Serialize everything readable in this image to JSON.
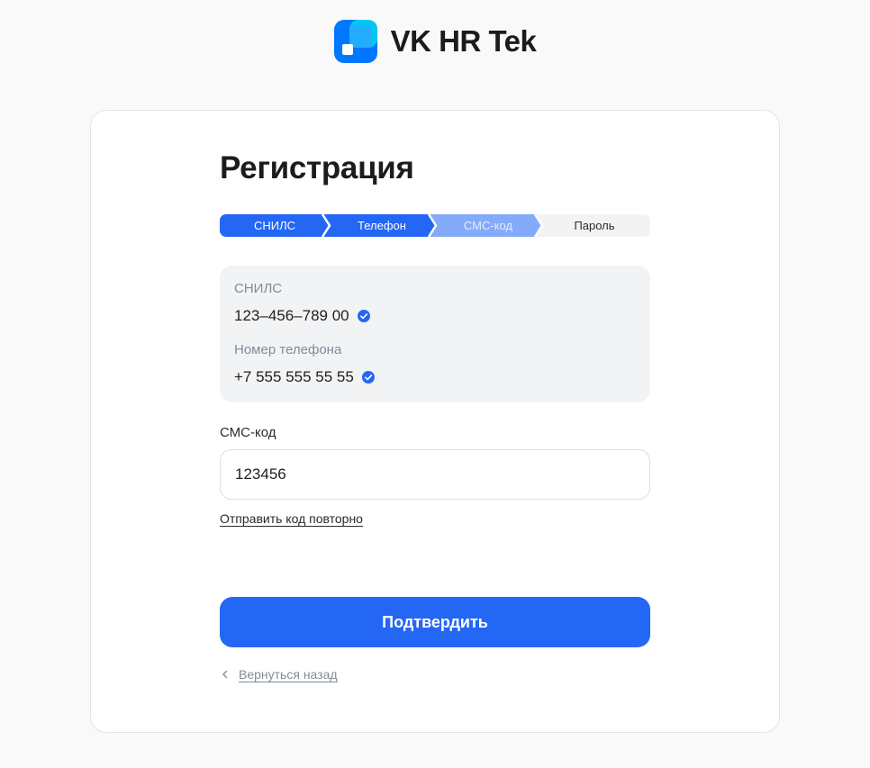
{
  "brand": {
    "name": "VK HR Tek"
  },
  "colors": {
    "accent": "#2467f5",
    "step_active": "#2467f5",
    "step_current": "#84aafa",
    "step_pending": "#f2f3f5"
  },
  "page": {
    "title": "Регистрация"
  },
  "stepper": {
    "steps": [
      {
        "label": "СНИЛС",
        "state": "done"
      },
      {
        "label": "Телефон",
        "state": "done"
      },
      {
        "label": "СМС-код",
        "state": "current"
      },
      {
        "label": "Пароль",
        "state": "pending"
      }
    ]
  },
  "summary": {
    "snils_label": "СНИЛС",
    "snils_value": "123–456–789 00",
    "phone_label": "Номер телефона",
    "phone_value": "+7 555 555 55 55"
  },
  "sms": {
    "label": "СМС-код",
    "value": "123456",
    "resend_label": "Отправить код повторно"
  },
  "actions": {
    "confirm_label": "Подтвердить",
    "back_label": "Вернуться назад"
  },
  "icons": [
    "logo-icon",
    "check-icon",
    "chevron-left-icon"
  ]
}
